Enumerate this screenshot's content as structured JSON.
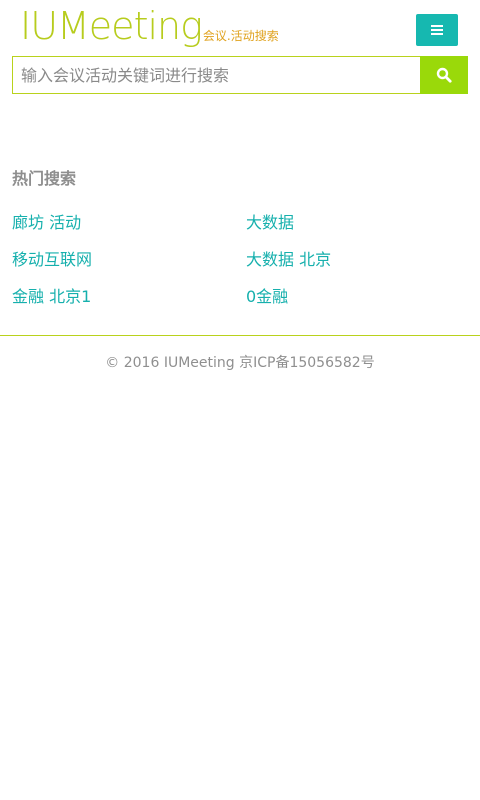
{
  "header": {
    "logo_main": "IUMeeting",
    "logo_sub": "会议.活动搜索",
    "menu_icon": "hamburger-menu-icon"
  },
  "search": {
    "placeholder": "输入会议活动关键词进行搜索",
    "value": "",
    "button_icon": "search-icon"
  },
  "hot": {
    "title": "热门搜索",
    "items": [
      "廊坊 活动",
      "大数据",
      "移动互联网",
      "大数据 北京",
      "金融 北京1",
      "0金融"
    ]
  },
  "footer": {
    "copyright": "© 2016 IUMeeting 京ICP备15056582号"
  },
  "colors": {
    "logo_green": "#b7cc1d",
    "logo_orange": "#e0a320",
    "menu_teal": "#16b8b0",
    "search_green": "#9ad90a",
    "link_teal": "#16b0ad",
    "divider": "#b9d21c"
  }
}
